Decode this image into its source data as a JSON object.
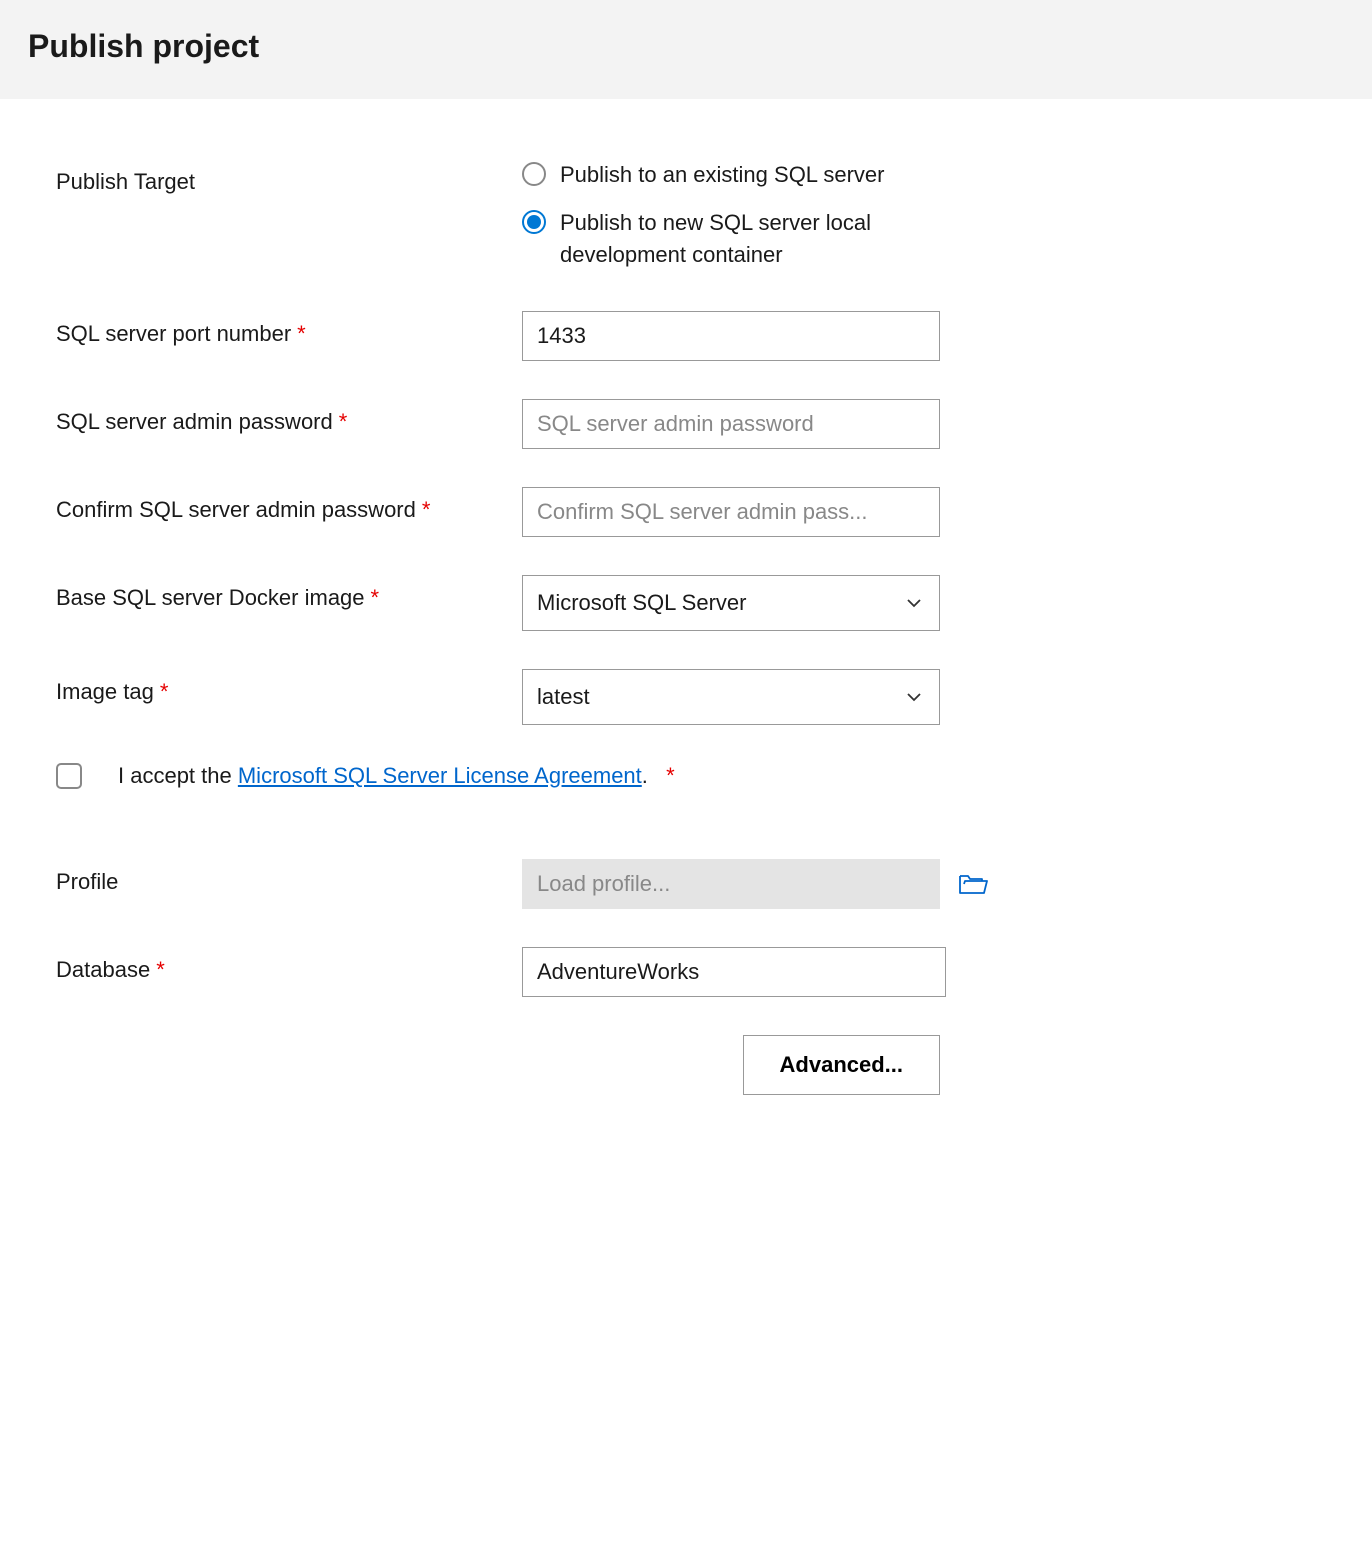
{
  "header": {
    "title": "Publish project"
  },
  "form": {
    "publishTarget": {
      "label": "Publish Target",
      "option1": "Publish to an existing SQL server",
      "option2": "Publish to new SQL server local development container",
      "selected": "option2"
    },
    "port": {
      "label": "SQL server port number",
      "value": "1433"
    },
    "adminPassword": {
      "label": "SQL server admin password",
      "placeholder": "SQL server admin password",
      "value": ""
    },
    "confirmPassword": {
      "label": "Confirm SQL server admin password",
      "placeholder": "Confirm SQL server admin pass...",
      "value": ""
    },
    "dockerImage": {
      "label": "Base SQL server Docker image",
      "value": "Microsoft SQL Server"
    },
    "imageTag": {
      "label": "Image tag",
      "value": "latest"
    },
    "license": {
      "prefix": "I accept the ",
      "linkText": "Microsoft SQL Server License Agreement",
      "suffix": "."
    },
    "profile": {
      "label": "Profile",
      "placeholder": "Load profile...",
      "value": ""
    },
    "database": {
      "label": "Database",
      "value": "AdventureWorks"
    },
    "advancedButton": "Advanced..."
  }
}
